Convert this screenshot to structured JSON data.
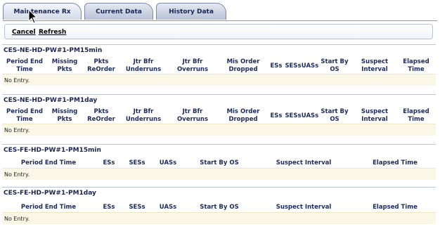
{
  "tabs": [
    {
      "label": "Maintenance Rx"
    },
    {
      "label": "Current Data"
    },
    {
      "label": "History Data"
    }
  ],
  "actions": {
    "cancel": "Cancel",
    "refresh": "Refresh"
  },
  "sections": [
    {
      "title": "CES-NE-HD-PW#1-PM15min",
      "headers": [
        "Period End Time",
        "Missing Pkts",
        "Pkts ReOrder",
        "Jtr Bfr Underruns",
        "Jtr Bfr Overruns",
        "Mis Order Dropped",
        "ESs",
        "SESs",
        "UASs",
        "Start By OS",
        "Suspect Interval",
        "Elapsed Time"
      ],
      "empty_text": "No Entry."
    },
    {
      "title": "CES-NE-HD-PW#1-PM1day",
      "headers": [
        "Period End Time",
        "Missing Pkts",
        "Pkts ReOrder",
        "Jtr Bfr Underruns",
        "Jtr Bfr Overruns",
        "Mis Order Dropped",
        "ESs",
        "SESs",
        "UASs",
        "Start By OS",
        "Suspect Interval",
        "Elapsed Time"
      ],
      "empty_text": "No Entry."
    },
    {
      "title": "CES-FE-HD-PW#1-PM15min",
      "headers": [
        "Period End Time",
        "ESs",
        "SESs",
        "UASs",
        "Start By OS",
        "Suspect Interval",
        "Elapsed Time"
      ],
      "empty_text": "No Entry."
    },
    {
      "title": "CES-FE-HD-PW#1-PM1day",
      "headers": [
        "Period End Time",
        "ESs",
        "SESs",
        "UASs",
        "Start By OS",
        "Suspect Interval",
        "Elapsed Time"
      ],
      "empty_text": "No Entry."
    }
  ]
}
